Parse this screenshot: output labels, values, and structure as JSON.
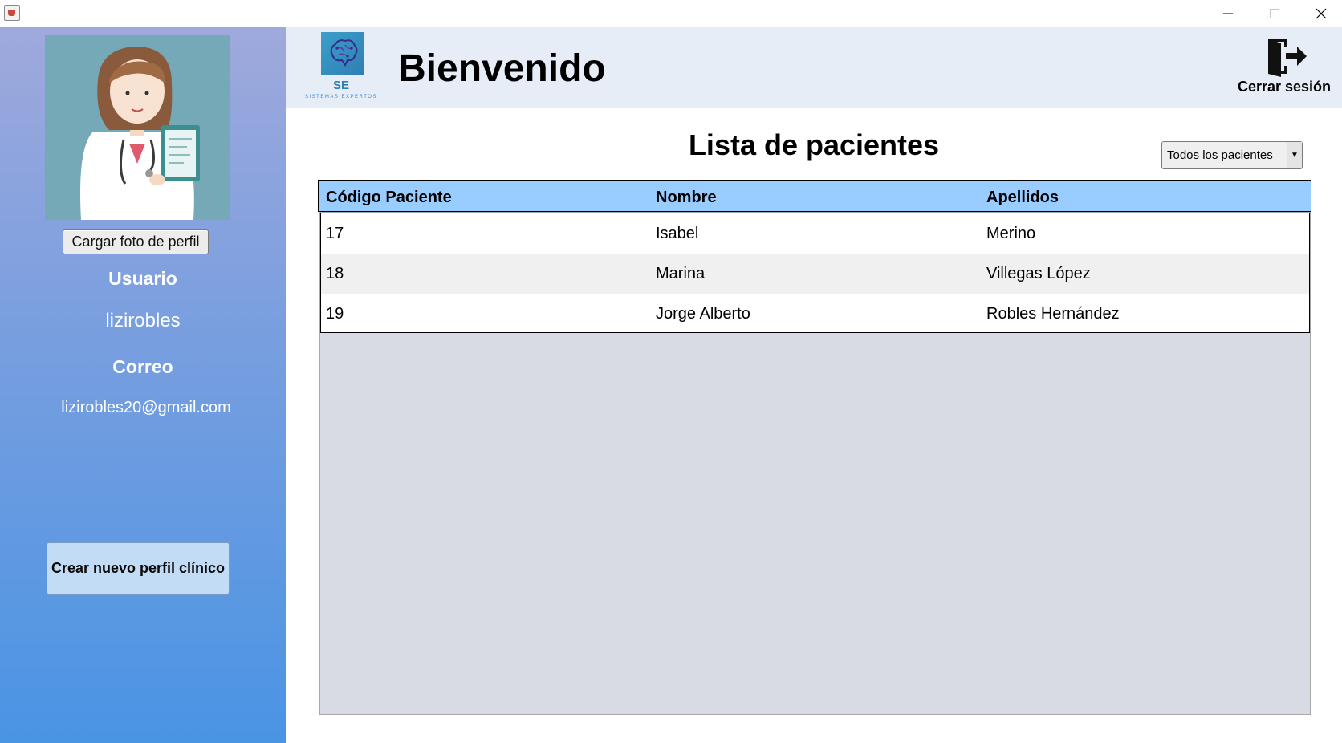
{
  "window": {
    "icon": "java-app-icon"
  },
  "sidebar": {
    "avatar": "doctor-avatar",
    "load_photo_label": "Cargar foto de perfil",
    "user_label": "Usuario",
    "username": "lizirobles",
    "email_label": "Correo",
    "email": "lizirobles20@gmail.com",
    "new_profile_label": "Crear nuevo perfil clínico",
    "gradient_top": "#9fa9dc",
    "gradient_bottom": "#4a94e4"
  },
  "header": {
    "logo_abbr": "SE",
    "logo_sub": "SISTEMAS EXPERTOS",
    "welcome": "Bienvenido",
    "logout_label": "Cerrar sesión"
  },
  "main": {
    "title": "Lista de pacientes",
    "filter_selected": "Todos los pacientes",
    "table": {
      "header_color": "#99ccff",
      "columns": [
        "Código Paciente",
        "Nombre",
        "Apellidos"
      ],
      "rows": [
        [
          "17",
          "Isabel",
          "Merino"
        ],
        [
          "18",
          "Marina",
          "Villegas López"
        ],
        [
          "19",
          "Jorge Alberto",
          "Robles Hernández"
        ]
      ]
    }
  }
}
